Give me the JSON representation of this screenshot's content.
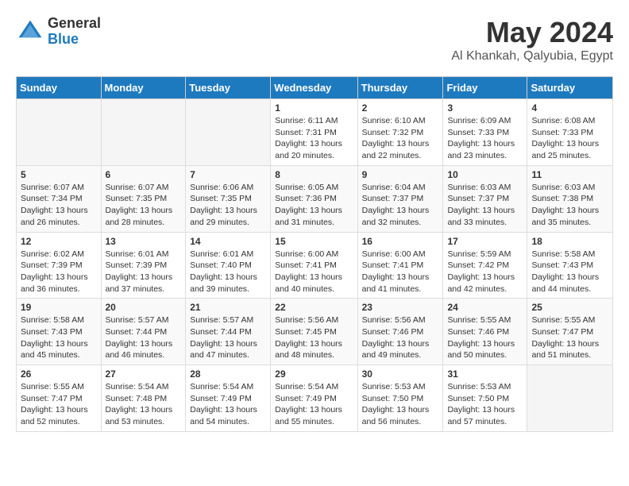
{
  "header": {
    "logo_general": "General",
    "logo_blue": "Blue",
    "month_year": "May 2024",
    "location": "Al Khankah, Qalyubia, Egypt"
  },
  "weekdays": [
    "Sunday",
    "Monday",
    "Tuesday",
    "Wednesday",
    "Thursday",
    "Friday",
    "Saturday"
  ],
  "weeks": [
    [
      {
        "day": "",
        "sunrise": "",
        "sunset": "",
        "daylight": ""
      },
      {
        "day": "",
        "sunrise": "",
        "sunset": "",
        "daylight": ""
      },
      {
        "day": "",
        "sunrise": "",
        "sunset": "",
        "daylight": ""
      },
      {
        "day": "1",
        "sunrise": "Sunrise: 6:11 AM",
        "sunset": "Sunset: 7:31 PM",
        "daylight": "Daylight: 13 hours and 20 minutes."
      },
      {
        "day": "2",
        "sunrise": "Sunrise: 6:10 AM",
        "sunset": "Sunset: 7:32 PM",
        "daylight": "Daylight: 13 hours and 22 minutes."
      },
      {
        "day": "3",
        "sunrise": "Sunrise: 6:09 AM",
        "sunset": "Sunset: 7:33 PM",
        "daylight": "Daylight: 13 hours and 23 minutes."
      },
      {
        "day": "4",
        "sunrise": "Sunrise: 6:08 AM",
        "sunset": "Sunset: 7:33 PM",
        "daylight": "Daylight: 13 hours and 25 minutes."
      }
    ],
    [
      {
        "day": "5",
        "sunrise": "Sunrise: 6:07 AM",
        "sunset": "Sunset: 7:34 PM",
        "daylight": "Daylight: 13 hours and 26 minutes."
      },
      {
        "day": "6",
        "sunrise": "Sunrise: 6:07 AM",
        "sunset": "Sunset: 7:35 PM",
        "daylight": "Daylight: 13 hours and 28 minutes."
      },
      {
        "day": "7",
        "sunrise": "Sunrise: 6:06 AM",
        "sunset": "Sunset: 7:35 PM",
        "daylight": "Daylight: 13 hours and 29 minutes."
      },
      {
        "day": "8",
        "sunrise": "Sunrise: 6:05 AM",
        "sunset": "Sunset: 7:36 PM",
        "daylight": "Daylight: 13 hours and 31 minutes."
      },
      {
        "day": "9",
        "sunrise": "Sunrise: 6:04 AM",
        "sunset": "Sunset: 7:37 PM",
        "daylight": "Daylight: 13 hours and 32 minutes."
      },
      {
        "day": "10",
        "sunrise": "Sunrise: 6:03 AM",
        "sunset": "Sunset: 7:37 PM",
        "daylight": "Daylight: 13 hours and 33 minutes."
      },
      {
        "day": "11",
        "sunrise": "Sunrise: 6:03 AM",
        "sunset": "Sunset: 7:38 PM",
        "daylight": "Daylight: 13 hours and 35 minutes."
      }
    ],
    [
      {
        "day": "12",
        "sunrise": "Sunrise: 6:02 AM",
        "sunset": "Sunset: 7:39 PM",
        "daylight": "Daylight: 13 hours and 36 minutes."
      },
      {
        "day": "13",
        "sunrise": "Sunrise: 6:01 AM",
        "sunset": "Sunset: 7:39 PM",
        "daylight": "Daylight: 13 hours and 37 minutes."
      },
      {
        "day": "14",
        "sunrise": "Sunrise: 6:01 AM",
        "sunset": "Sunset: 7:40 PM",
        "daylight": "Daylight: 13 hours and 39 minutes."
      },
      {
        "day": "15",
        "sunrise": "Sunrise: 6:00 AM",
        "sunset": "Sunset: 7:41 PM",
        "daylight": "Daylight: 13 hours and 40 minutes."
      },
      {
        "day": "16",
        "sunrise": "Sunrise: 6:00 AM",
        "sunset": "Sunset: 7:41 PM",
        "daylight": "Daylight: 13 hours and 41 minutes."
      },
      {
        "day": "17",
        "sunrise": "Sunrise: 5:59 AM",
        "sunset": "Sunset: 7:42 PM",
        "daylight": "Daylight: 13 hours and 42 minutes."
      },
      {
        "day": "18",
        "sunrise": "Sunrise: 5:58 AM",
        "sunset": "Sunset: 7:43 PM",
        "daylight": "Daylight: 13 hours and 44 minutes."
      }
    ],
    [
      {
        "day": "19",
        "sunrise": "Sunrise: 5:58 AM",
        "sunset": "Sunset: 7:43 PM",
        "daylight": "Daylight: 13 hours and 45 minutes."
      },
      {
        "day": "20",
        "sunrise": "Sunrise: 5:57 AM",
        "sunset": "Sunset: 7:44 PM",
        "daylight": "Daylight: 13 hours and 46 minutes."
      },
      {
        "day": "21",
        "sunrise": "Sunrise: 5:57 AM",
        "sunset": "Sunset: 7:44 PM",
        "daylight": "Daylight: 13 hours and 47 minutes."
      },
      {
        "day": "22",
        "sunrise": "Sunrise: 5:56 AM",
        "sunset": "Sunset: 7:45 PM",
        "daylight": "Daylight: 13 hours and 48 minutes."
      },
      {
        "day": "23",
        "sunrise": "Sunrise: 5:56 AM",
        "sunset": "Sunset: 7:46 PM",
        "daylight": "Daylight: 13 hours and 49 minutes."
      },
      {
        "day": "24",
        "sunrise": "Sunrise: 5:55 AM",
        "sunset": "Sunset: 7:46 PM",
        "daylight": "Daylight: 13 hours and 50 minutes."
      },
      {
        "day": "25",
        "sunrise": "Sunrise: 5:55 AM",
        "sunset": "Sunset: 7:47 PM",
        "daylight": "Daylight: 13 hours and 51 minutes."
      }
    ],
    [
      {
        "day": "26",
        "sunrise": "Sunrise: 5:55 AM",
        "sunset": "Sunset: 7:47 PM",
        "daylight": "Daylight: 13 hours and 52 minutes."
      },
      {
        "day": "27",
        "sunrise": "Sunrise: 5:54 AM",
        "sunset": "Sunset: 7:48 PM",
        "daylight": "Daylight: 13 hours and 53 minutes."
      },
      {
        "day": "28",
        "sunrise": "Sunrise: 5:54 AM",
        "sunset": "Sunset: 7:49 PM",
        "daylight": "Daylight: 13 hours and 54 minutes."
      },
      {
        "day": "29",
        "sunrise": "Sunrise: 5:54 AM",
        "sunset": "Sunset: 7:49 PM",
        "daylight": "Daylight: 13 hours and 55 minutes."
      },
      {
        "day": "30",
        "sunrise": "Sunrise: 5:53 AM",
        "sunset": "Sunset: 7:50 PM",
        "daylight": "Daylight: 13 hours and 56 minutes."
      },
      {
        "day": "31",
        "sunrise": "Sunrise: 5:53 AM",
        "sunset": "Sunset: 7:50 PM",
        "daylight": "Daylight: 13 hours and 57 minutes."
      },
      {
        "day": "",
        "sunrise": "",
        "sunset": "",
        "daylight": ""
      }
    ]
  ]
}
